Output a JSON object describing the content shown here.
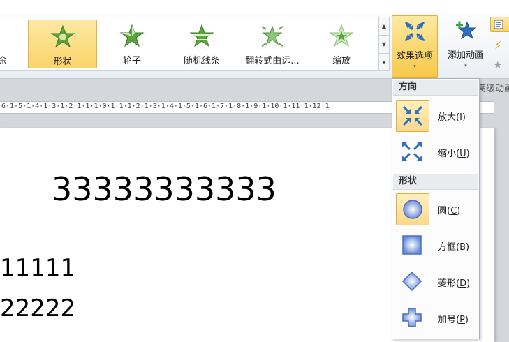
{
  "ribbon": {
    "gallery": {
      "partial_label": "涂",
      "items": [
        {
          "label": "形状",
          "icon": "star-shape-icon",
          "selected": true
        },
        {
          "label": "轮子",
          "icon": "star-wheel-icon",
          "selected": false
        },
        {
          "label": "随机线条",
          "icon": "star-random-bars-icon",
          "selected": false
        },
        {
          "label": "翻转式由远...",
          "icon": "star-flip-icon",
          "selected": false
        },
        {
          "label": "缩放",
          "icon": "star-zoom-icon",
          "selected": false
        }
      ],
      "scroll_up": "▲",
      "scroll_down": "▼",
      "scroll_more": "▾"
    },
    "effect_options": {
      "label": "效果选项",
      "arrow": "▾"
    },
    "add_animation": {
      "label": "添加动画",
      "arrow": "▾"
    },
    "side_strip": {
      "s1": "",
      "s2": "",
      "s3": ""
    },
    "advanced_group_label": "高级动画"
  },
  "ruler": {
    "marks": "6·1·5·1·4·1·3·1·2·1·1·1·0·1·1·1·2·1·3·1·4·1·5·1·6·1·7·1·8·1·9·1·10·1·11·1·12·1"
  },
  "slide": {
    "line1": "33333333333",
    "line2": "11111",
    "line3": "22222"
  },
  "menu": {
    "section_direction": "方向",
    "section_shape": "形状",
    "items": [
      {
        "text": "放大(",
        "key": "I",
        "end": ")",
        "icon": "zoom-in-arrows-icon",
        "selected": true
      },
      {
        "text": "缩小(",
        "key": "U",
        "end": ")",
        "icon": "zoom-out-arrows-icon",
        "selected": false
      },
      {
        "text": "圆(",
        "key": "C",
        "end": ")",
        "icon": "circle-shape-icon",
        "selected": true
      },
      {
        "text": "方框(",
        "key": "B",
        "end": ")",
        "icon": "box-shape-icon",
        "selected": false
      },
      {
        "text": "菱形(",
        "key": "D",
        "end": ")",
        "icon": "diamond-shape-icon",
        "selected": false
      },
      {
        "text": "加号(",
        "key": "P",
        "end": ")",
        "icon": "plus-shape-icon",
        "selected": false
      }
    ]
  },
  "colors": {
    "selected_bg": "#fbd56a",
    "selected_border": "#e1ad42",
    "star_green": "#5aa53c",
    "arrow_blue": "#2f6fc2"
  }
}
